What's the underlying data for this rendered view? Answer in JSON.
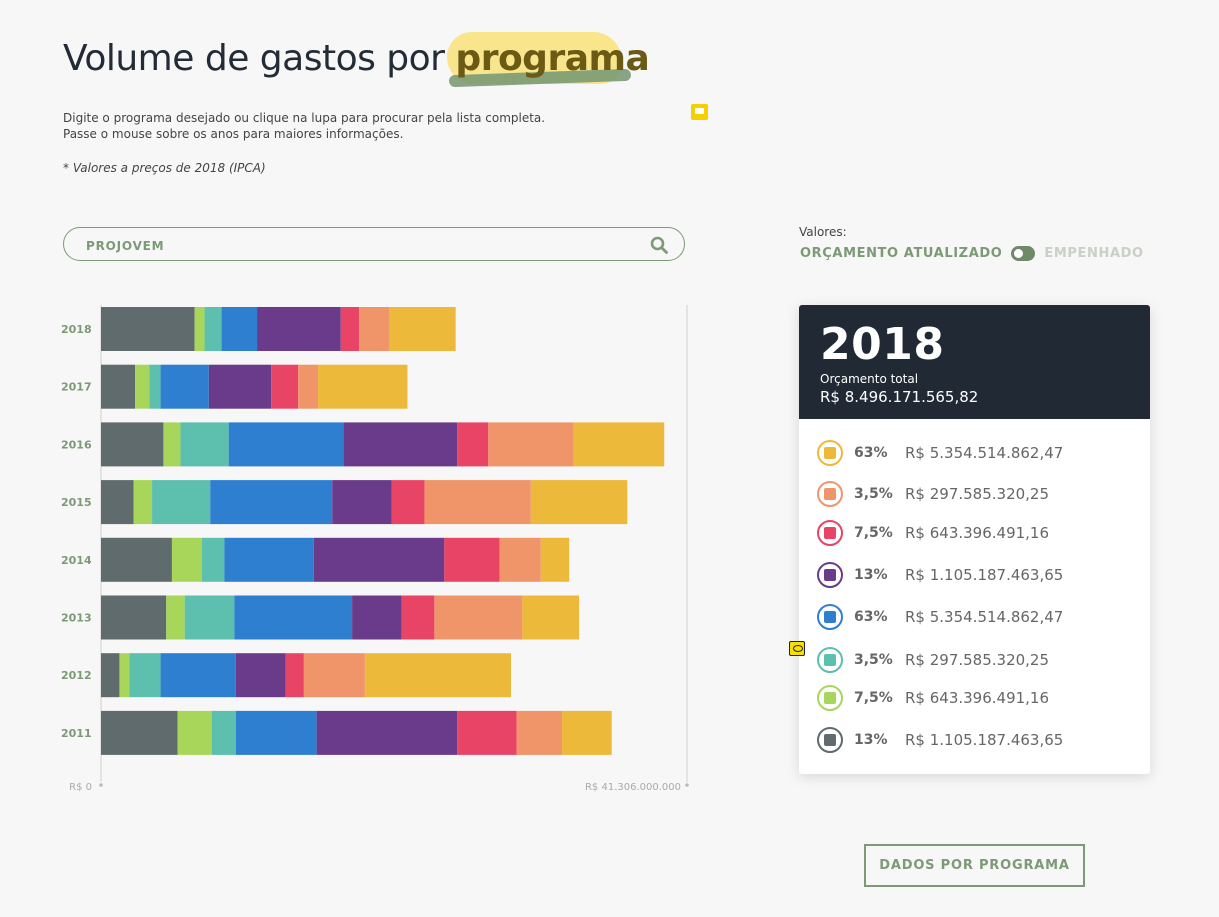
{
  "header": {
    "title_prefix": "Volume de gastos por",
    "title_highlight": "programa",
    "description_line1": "Digite o programa desejado ou clique na lupa para procurar pela lista completa.",
    "description_line2": "Passe o mouse sobre os anos para maiores informações.",
    "note": "* Valores a preços de 2018 (IPCA)"
  },
  "search": {
    "value": "PROJOVEM",
    "icon": "search-icon"
  },
  "values_toggle": {
    "label": "Valores:",
    "option_active": "ORÇAMENTO ATUALIZADO",
    "option_inactive": "EMPENHADO"
  },
  "colors": {
    "accent_green": "#7b9a75",
    "dark_panel": "#212a34"
  },
  "chart_data": {
    "type": "bar",
    "orientation": "horizontal",
    "stacked": true,
    "categories": [
      "2018",
      "2017",
      "2016",
      "2015",
      "2014",
      "2013",
      "2012",
      "2011"
    ],
    "xlim": [
      0,
      41306000000
    ],
    "axis_min_label": "R$ 0",
    "axis_max_label": "R$ 41.306.000.000",
    "series_colors": [
      "#5f6b6c",
      "#a8d65a",
      "#5dbfae",
      "#2f7fd1",
      "#6a3b8a",
      "#e84465",
      "#f0956a",
      "#edb93b"
    ],
    "series": [
      {
        "values": [
          6600000000,
          2400000000,
          4400000000,
          2300000000,
          5000000000,
          4600000000,
          1300000000,
          5400000000
        ]
      },
      {
        "values": [
          700000000,
          1000000000,
          1200000000,
          1300000000,
          2100000000,
          1300000000,
          700000000,
          2400000000
        ]
      },
      {
        "values": [
          1200000000,
          800000000,
          3400000000,
          4100000000,
          1600000000,
          3500000000,
          2200000000,
          1700000000
        ]
      },
      {
        "values": [
          2500000000,
          3400000000,
          8100000000,
          8600000000,
          6300000000,
          8300000000,
          5300000000,
          5700000000
        ]
      },
      {
        "values": [
          5900000000,
          4400000000,
          8000000000,
          4200000000,
          9200000000,
          3500000000,
          3500000000,
          9900000000
        ]
      },
      {
        "values": [
          1300000000,
          1900000000,
          2200000000,
          2300000000,
          3900000000,
          2300000000,
          1300000000,
          4200000000
        ]
      },
      {
        "values": [
          2100000000,
          1400000000,
          6000000000,
          7500000000,
          2900000000,
          6200000000,
          4300000000,
          3200000000
        ]
      },
      {
        "values": [
          4700000000,
          6300000000,
          6400000000,
          6800000000,
          2000000000,
          4000000000,
          10300000000,
          3500000000
        ]
      }
    ]
  },
  "year_card": {
    "year": "2018",
    "subtitle": "Orçamento total",
    "total": "R$ 8.496.171.565,82",
    "items": [
      {
        "icon": "money-icon",
        "color": "#edb93b",
        "pct": "63%",
        "value": "R$ 5.354.514.862,47"
      },
      {
        "icon": "dollar-icon",
        "color": "#f0956a",
        "pct": "3,5%",
        "value": "R$ 297.585.320,25"
      },
      {
        "icon": "calendar-icon",
        "color": "#e84465",
        "pct": "7,5%",
        "value": "R$ 643.396.491,16"
      },
      {
        "icon": "message-icon",
        "color": "#6a3b8a",
        "pct": "13%",
        "value": "R$ 1.105.187.463,65"
      },
      {
        "icon": "building-icon",
        "color": "#2f7fd1",
        "pct": "63%",
        "value": "R$ 5.354.514.862,47"
      },
      {
        "icon": "hammer-icon",
        "color": "#5dbfae",
        "pct": "3,5%",
        "value": "R$ 297.585.320,25"
      },
      {
        "icon": "person-icon",
        "color": "#a8d65a",
        "pct": "7,5%",
        "value": "R$ 643.396.491,16"
      },
      {
        "icon": "wrench-icon",
        "color": "#5f6b6c",
        "pct": "13%",
        "value": "R$ 1.105.187.463,65"
      }
    ]
  },
  "footer": {
    "button_label": "DADOS POR PROGRAMA"
  }
}
